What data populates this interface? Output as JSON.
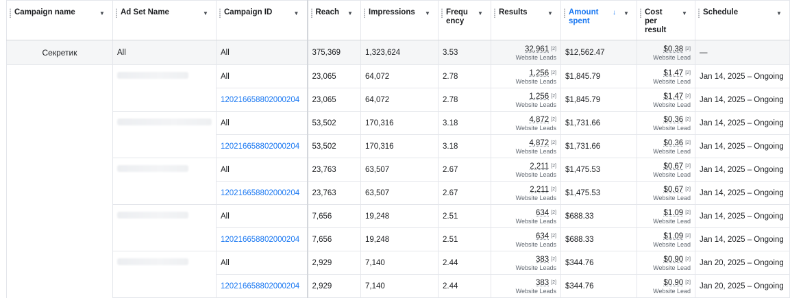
{
  "columns": [
    {
      "label": "Campaign name"
    },
    {
      "label": "Ad Set Name"
    },
    {
      "label": "Campaign ID"
    },
    {
      "label": "Reach"
    },
    {
      "label": "Impressions"
    },
    {
      "label": "Frequ ency"
    },
    {
      "label": "Results"
    },
    {
      "label": "Amount spent",
      "sort_icon": "sort-desc-icon",
      "color": "#1877f2"
    },
    {
      "label": "Cost per result"
    },
    {
      "label": "Schedule"
    }
  ],
  "summary": {
    "campaign_name": "Секретик",
    "ad_set": "All",
    "campaign_id": "All",
    "reach": "375,369",
    "impressions": "1,323,624",
    "frequency": "3.53",
    "results": "32,961",
    "results_sup": "[2]",
    "results_sub": "Website Leads",
    "amount": "$12,562.47",
    "cpr": "$0.38",
    "cpr_sup": "[2]",
    "cpr_sub": "Website Lead",
    "schedule": "—"
  },
  "rows": [
    {
      "campaign_id": "All",
      "reach": "23,065",
      "impressions": "64,072",
      "frequency": "2.78",
      "results": "1,256",
      "results_sup": "[2]",
      "results_sub": "Website Leads",
      "amount": "$1,845.79",
      "cpr": "$1.47",
      "cpr_sup": "[2]",
      "cpr_sub": "Website Lead",
      "schedule": "Jan 14, 2025 – Ongoing"
    },
    {
      "campaign_id": "120216658802000204",
      "reach": "23,065",
      "impressions": "64,072",
      "frequency": "2.78",
      "results": "1,256",
      "results_sup": "[2]",
      "results_sub": "Website Leads",
      "amount": "$1,845.79",
      "cpr": "$1.47",
      "cpr_sup": "[2]",
      "cpr_sub": "Website Lead",
      "schedule": "Jan 14, 2025 – Ongoing"
    },
    {
      "campaign_id": "All",
      "reach": "53,502",
      "impressions": "170,316",
      "frequency": "3.18",
      "results": "4,872",
      "results_sup": "[2]",
      "results_sub": "Website Leads",
      "amount": "$1,731.66",
      "cpr": "$0.36",
      "cpr_sup": "[2]",
      "cpr_sub": "Website Lead",
      "schedule": "Jan 14, 2025 – Ongoing"
    },
    {
      "campaign_id": "120216658802000204",
      "reach": "53,502",
      "impressions": "170,316",
      "frequency": "3.18",
      "results": "4,872",
      "results_sup": "[2]",
      "results_sub": "Website Leads",
      "amount": "$1,731.66",
      "cpr": "$0.36",
      "cpr_sup": "[2]",
      "cpr_sub": "Website Lead",
      "schedule": "Jan 14, 2025 – Ongoing"
    },
    {
      "campaign_id": "All",
      "reach": "23,763",
      "impressions": "63,507",
      "frequency": "2.67",
      "results": "2,211",
      "results_sup": "[2]",
      "results_sub": "Website Leads",
      "amount": "$1,475.53",
      "cpr": "$0.67",
      "cpr_sup": "[2]",
      "cpr_sub": "Website Lead",
      "schedule": "Jan 14, 2025 – Ongoing"
    },
    {
      "campaign_id": "120216658802000204",
      "reach": "23,763",
      "impressions": "63,507",
      "frequency": "2.67",
      "results": "2,211",
      "results_sup": "[2]",
      "results_sub": "Website Leads",
      "amount": "$1,475.53",
      "cpr": "$0.67",
      "cpr_sup": "[2]",
      "cpr_sub": "Website Lead",
      "schedule": "Jan 14, 2025 – Ongoing"
    },
    {
      "campaign_id": "All",
      "reach": "7,656",
      "impressions": "19,248",
      "frequency": "2.51",
      "results": "634",
      "results_sup": "[2]",
      "results_sub": "Website Leads",
      "amount": "$688.33",
      "cpr": "$1.09",
      "cpr_sup": "[2]",
      "cpr_sub": "Website Lead",
      "schedule": "Jan 14, 2025 – Ongoing"
    },
    {
      "campaign_id": "120216658802000204",
      "reach": "7,656",
      "impressions": "19,248",
      "frequency": "2.51",
      "results": "634",
      "results_sup": "[2]",
      "results_sub": "Website Leads",
      "amount": "$688.33",
      "cpr": "$1.09",
      "cpr_sup": "[2]",
      "cpr_sub": "Website Lead",
      "schedule": "Jan 14, 2025 – Ongoing"
    },
    {
      "campaign_id": "All",
      "reach": "2,929",
      "impressions": "7,140",
      "frequency": "2.44",
      "results": "383",
      "results_sup": "[2]",
      "results_sub": "Website Leads",
      "amount": "$344.76",
      "cpr": "$0.90",
      "cpr_sup": "[2]",
      "cpr_sub": "Website Lead",
      "schedule": "Jan 20, 2025 – Ongoing"
    },
    {
      "campaign_id": "120216658802000204",
      "reach": "2,929",
      "impressions": "7,140",
      "frequency": "2.44",
      "results": "383",
      "results_sup": "[2]",
      "results_sub": "Website Leads",
      "amount": "$344.76",
      "cpr": "$0.90",
      "cpr_sup": "[2]",
      "cpr_sub": "Website Lead",
      "schedule": "Jan 20, 2025 – Ongoing"
    }
  ],
  "icons": {
    "dropdown": "chevron-down-icon",
    "column_grip": "drag-handle-icon"
  },
  "colors": {
    "link": "#1877f2",
    "summary_bg": "#f5f6f7",
    "border": "#e4e6eb"
  }
}
